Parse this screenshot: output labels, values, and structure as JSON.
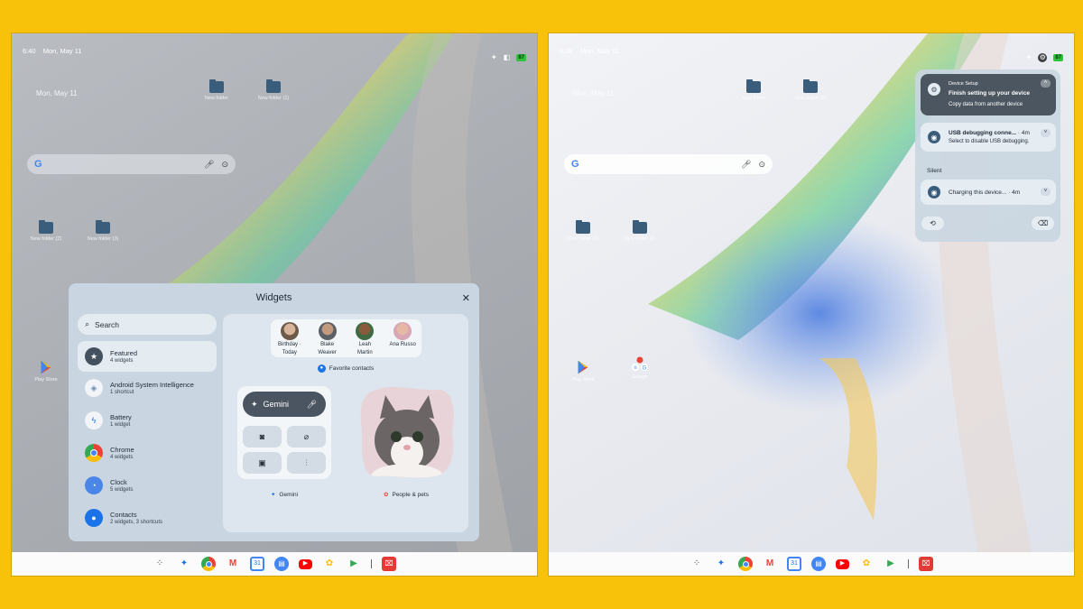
{
  "left_screen": {
    "status": {
      "time": "6:40",
      "date": "Mon, May 11",
      "battery": "87"
    },
    "date_widget": "Mon, May 11",
    "folders": [
      {
        "label": "New folder"
      },
      {
        "label": "New folder (1)"
      },
      {
        "label": "New folder (2)"
      },
      {
        "label": "New folder (3)"
      }
    ],
    "apps": [
      {
        "label": "Play Store"
      }
    ],
    "widgets_panel": {
      "title": "Widgets",
      "close_icon": "close-icon",
      "search_label": "Search",
      "categories": [
        {
          "name": "Featured",
          "sub": "4 widgets",
          "icon": "star-icon"
        },
        {
          "name": "Android System Intelligence",
          "sub": "1 shortcut",
          "icon": "asi-icon"
        },
        {
          "name": "Battery",
          "sub": "1 widget",
          "icon": "battery-icon"
        },
        {
          "name": "Chrome",
          "sub": "4 widgets",
          "icon": "chrome-icon"
        },
        {
          "name": "Clock",
          "sub": "5 widgets",
          "icon": "clock-icon"
        },
        {
          "name": "Contacts",
          "sub": "2 widgets, 3 shortcuts",
          "icon": "contacts-icon"
        }
      ],
      "favorite_contacts": {
        "contacts": [
          {
            "name": "Birthday ·\nToday",
            "name_line1": "Birthday ·",
            "name_line2": "Today"
          },
          {
            "name_line1": "Blake",
            "name_line2": "Weaver"
          },
          {
            "name_line1": "Leah",
            "name_line2": "Martin"
          },
          {
            "name_line1": "Ana Russo",
            "name_line2": ""
          }
        ],
        "caption": "Favorite contacts"
      },
      "gemini": {
        "pill_label": "Gemini",
        "caption": "Gemini"
      },
      "people_pets": {
        "caption": "People & pets"
      }
    }
  },
  "right_screen": {
    "status": {
      "time": "6:38",
      "date": "Mon, May 11",
      "battery": "87"
    },
    "date_widget": "Mon, May 11",
    "folders": [
      {
        "label": "New folder"
      },
      {
        "label": "New folder (1)"
      },
      {
        "label": "New folder (2)"
      },
      {
        "label": "New folder (3)"
      }
    ],
    "apps": [
      {
        "label": "Play Store"
      },
      {
        "label": "Google"
      }
    ],
    "notifications": {
      "setup": {
        "app": "Device Setup",
        "title": "Finish setting up your device",
        "text": "Copy data from another device"
      },
      "usb": {
        "title": "USB debugging conne...",
        "time": "· 4m",
        "text": "Select to disable USB debugging."
      },
      "silent_label": "Silent",
      "charging": {
        "title": "Charging this device...",
        "time": "· 4m"
      }
    }
  },
  "shelf_icons": [
    "launcher-icon",
    "gemini-icon",
    "chrome-icon",
    "gmail-icon",
    "calendar-icon",
    "files-icon",
    "youtube-icon",
    "photos-icon",
    "play-store-icon",
    "media-app-icon"
  ],
  "colors": {
    "background": "#f9c20a",
    "panel": "#c9d6e1",
    "dark_card": "#4b5661",
    "folder": "#3b5d7c"
  }
}
